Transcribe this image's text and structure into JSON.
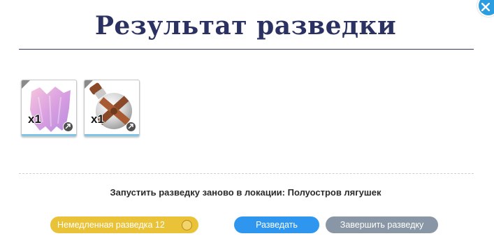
{
  "dialog": {
    "title": "Результат разведки",
    "close_icon": "close-icon"
  },
  "rewards": [
    {
      "icon": "pink-cape-icon",
      "quantity": "x1"
    },
    {
      "icon": "potion-flask-icon",
      "quantity": "x1"
    }
  ],
  "relaunch": {
    "text": "Запустить разведку заново в локации: Полуостров лягушек"
  },
  "buttons": {
    "instant_label": "Немедленная разведка 12",
    "instant_currency_icon": "coin-icon",
    "scout_label": "Разведать",
    "finish_label": "Завершить разведку"
  },
  "colors": {
    "title": "#2b3261",
    "instant": "#e9c237",
    "scout": "#2f96f0",
    "finish": "#8896a6",
    "close": "#2a9ee0"
  }
}
